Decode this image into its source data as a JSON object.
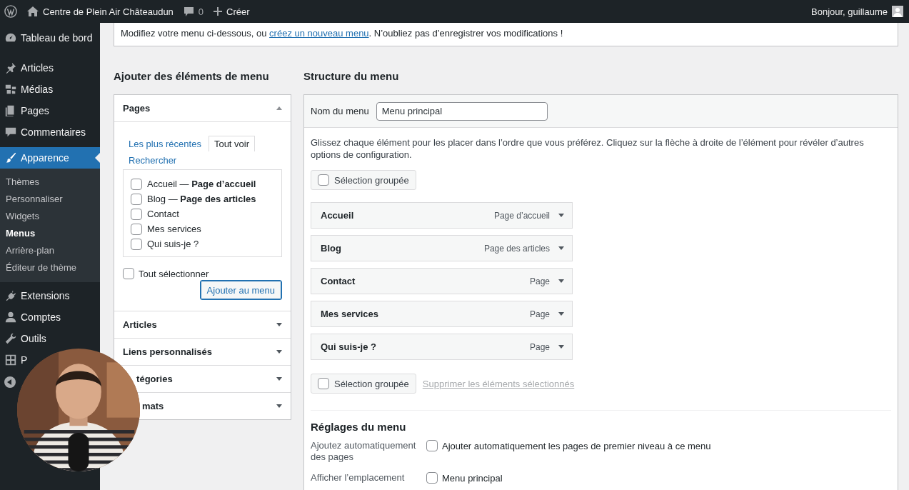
{
  "admin_bar": {
    "site_name": "Centre de Plein Air Châteaudun",
    "comments_count": "0",
    "new_label": "Créer",
    "greeting": "Bonjour, guillaume"
  },
  "sidebar": {
    "items": [
      {
        "label": "Tableau de bord",
        "selected": false
      },
      {
        "label": "Articles",
        "selected": false
      },
      {
        "label": "Médias",
        "selected": false
      },
      {
        "label": "Pages",
        "selected": false
      },
      {
        "label": "Commentaires",
        "selected": false
      },
      {
        "label": "Apparence",
        "selected": true,
        "children": [
          {
            "label": "Thèmes",
            "selected": false
          },
          {
            "label": "Personnaliser",
            "selected": false
          },
          {
            "label": "Widgets",
            "selected": false
          },
          {
            "label": "Menus",
            "selected": true
          },
          {
            "label": "Arrière-plan",
            "selected": false
          },
          {
            "label": "Éditeur de thème",
            "selected": false
          }
        ]
      },
      {
        "label": "Extensions",
        "selected": false
      },
      {
        "label": "Comptes",
        "selected": false
      },
      {
        "label": "Outils",
        "selected": false
      },
      {
        "label": "P",
        "selected": false
      }
    ]
  },
  "notice": {
    "before": "Modifiez votre menu ci-dessous, ou ",
    "link": "créez un nouveau menu",
    "after": ". N’oubliez pas d’enregistrer vos modifications !"
  },
  "add_items": {
    "title": "Ajouter des éléments de menu",
    "sections": [
      {
        "title": "Pages",
        "expanded": true,
        "tabs": [
          {
            "label": "Les plus récentes",
            "selected": false
          },
          {
            "label": "Tout voir",
            "selected": true
          },
          {
            "label": "Rechercher",
            "selected": false
          }
        ],
        "pages": [
          {
            "label": "Accueil — **Page d’accueil**",
            "checked": false
          },
          {
            "label": "Blog — **Page des articles**",
            "checked": false
          },
          {
            "label": "Contact",
            "checked": false
          },
          {
            "label": "Mes services",
            "checked": false
          },
          {
            "label": "Qui suis-je ?",
            "checked": false
          }
        ],
        "select_all": {
          "label": "Tout sélectionner",
          "checked": false
        },
        "button": "Ajouter au menu"
      },
      {
        "title": "Articles",
        "expanded": false
      },
      {
        "title": "Liens personnalisés",
        "expanded": false
      },
      {
        "title": "tégories",
        "expanded": false
      },
      {
        "title": "mats",
        "expanded": false
      }
    ]
  },
  "structure": {
    "title": "Structure du menu",
    "name_label": "Nom du menu",
    "name_value": "Menu principal",
    "instructions": "Glissez chaque élément pour les placer dans l’ordre que vous préférez. Cliquez sur la flèche à droite de l’élément pour révéler d’autres options de configuration.",
    "bulk_select_top": {
      "label": "Sélection groupée",
      "checked": false
    },
    "items": [
      {
        "title": "Accueil",
        "type": "Page d’accueil"
      },
      {
        "title": "Blog",
        "type": "Page des articles"
      },
      {
        "title": "Contact",
        "type": "Page"
      },
      {
        "title": "Mes services",
        "type": "Page"
      },
      {
        "title": "Qui suis-je ?",
        "type": "Page"
      }
    ],
    "bulk_select_bottom": {
      "label": "Sélection groupée",
      "checked": false
    },
    "delete_link": "Supprimer les éléments sélectionnés",
    "settings": {
      "title": "Réglages du menu",
      "rows": [
        {
          "label": "Ajoutez automatiquement des pages",
          "options": [
            {
              "label": "Ajouter automatiquement les pages de premier niveau à ce menu",
              "checked": false
            }
          ]
        },
        {
          "label": "Afficher l’emplacement",
          "options": [
            {
              "label": "Menu principal",
              "checked": false
            }
          ]
        }
      ]
    }
  }
}
